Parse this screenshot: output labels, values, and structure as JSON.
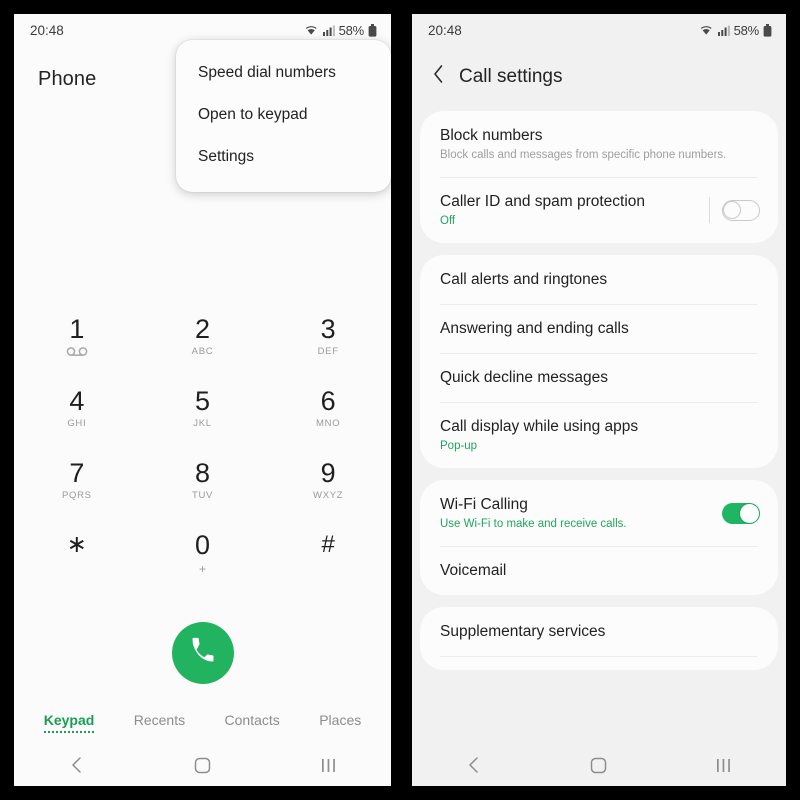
{
  "statusbar": {
    "time": "20:48",
    "battery_text": "58%",
    "wifi_icon": "wifi-icon",
    "signal_icon": "cellular-signal-icon",
    "battery_icon": "battery-icon"
  },
  "left_panel": {
    "app_title": "Phone",
    "overflow_menu": {
      "items": [
        {
          "label": "Speed dial numbers"
        },
        {
          "label": "Open to keypad"
        },
        {
          "label": "Settings"
        }
      ]
    },
    "dialpad": {
      "keys": [
        {
          "digit": "1",
          "sub": "",
          "icon": "voicemail-icon"
        },
        {
          "digit": "2",
          "sub": "ABC",
          "icon": ""
        },
        {
          "digit": "3",
          "sub": "DEF",
          "icon": ""
        },
        {
          "digit": "4",
          "sub": "GHI",
          "icon": ""
        },
        {
          "digit": "5",
          "sub": "JKL",
          "icon": ""
        },
        {
          "digit": "6",
          "sub": "MNO",
          "icon": ""
        },
        {
          "digit": "7",
          "sub": "PQRS",
          "icon": ""
        },
        {
          "digit": "8",
          "sub": "TUV",
          "icon": ""
        },
        {
          "digit": "9",
          "sub": "WXYZ",
          "icon": ""
        },
        {
          "digit": "∗",
          "sub": "",
          "icon": ""
        },
        {
          "digit": "0",
          "sub": "+",
          "icon": ""
        },
        {
          "digit": "#",
          "sub": "",
          "icon": ""
        }
      ]
    },
    "call_button": {
      "icon": "phone-handset-icon",
      "color": "#22b361"
    },
    "tabs": [
      {
        "label": "Keypad",
        "active": true
      },
      {
        "label": "Recents",
        "active": false
      },
      {
        "label": "Contacts",
        "active": false
      },
      {
        "label": "Places",
        "active": false
      }
    ]
  },
  "right_panel": {
    "header": {
      "back_icon": "chevron-left-icon",
      "title": "Call settings"
    },
    "groups": [
      {
        "rows": [
          {
            "title": "Block numbers",
            "sub": "Block calls and messages from specific phone numbers.",
            "sub_style": "gray",
            "toggle": null
          },
          {
            "title": "Caller ID and spam protection",
            "sub": "Off",
            "sub_style": "green",
            "toggle": "off"
          }
        ]
      },
      {
        "rows": [
          {
            "title": "Call alerts and ringtones",
            "sub": "",
            "sub_style": "",
            "toggle": null
          },
          {
            "title": "Answering and ending calls",
            "sub": "",
            "sub_style": "",
            "toggle": null
          },
          {
            "title": "Quick decline messages",
            "sub": "",
            "sub_style": "",
            "toggle": null
          },
          {
            "title": "Call display while using apps",
            "sub": "Pop-up",
            "sub_style": "green",
            "toggle": null
          }
        ]
      },
      {
        "rows": [
          {
            "title": "Wi-Fi Calling",
            "sub": "Use Wi-Fi to make and receive calls.",
            "sub_style": "green",
            "toggle": "on"
          },
          {
            "title": "Voicemail",
            "sub": "",
            "sub_style": "",
            "toggle": null
          }
        ]
      },
      {
        "rows": [
          {
            "title": "Supplementary services",
            "sub": "",
            "sub_style": "",
            "toggle": null
          }
        ]
      }
    ]
  },
  "navbar": {
    "back_icon": "nav-back-icon",
    "home_icon": "nav-home-icon",
    "recents_icon": "nav-recents-icon"
  },
  "colors": {
    "accent_green": "#1fb563",
    "call_green": "#22b361",
    "tab_green": "#1a9e56",
    "panel_left_bg": "#fbfbfb",
    "panel_right_bg": "#f1f1f1",
    "card_bg": "#fcfcfc"
  }
}
